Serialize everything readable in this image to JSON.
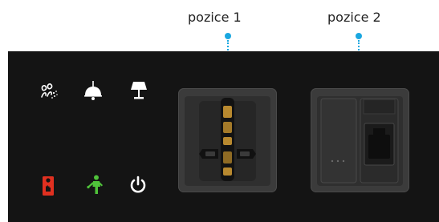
{
  "labels": {
    "position_1": "pozice 1",
    "position_2": "pozice 2"
  },
  "icons": [
    "scent-icon",
    "ceiling-lamp-icon",
    "table-lamp-icon",
    "do-not-disturb-icon",
    "service-person-icon",
    "power-icon"
  ],
  "colors": {
    "panel_background": "#141414",
    "pointer": "#1aa7e0",
    "dnd_red": "#e03020",
    "service_green": "#4fc23a",
    "icon_white": "#ffffff",
    "socket_gold": "#b8892f"
  }
}
